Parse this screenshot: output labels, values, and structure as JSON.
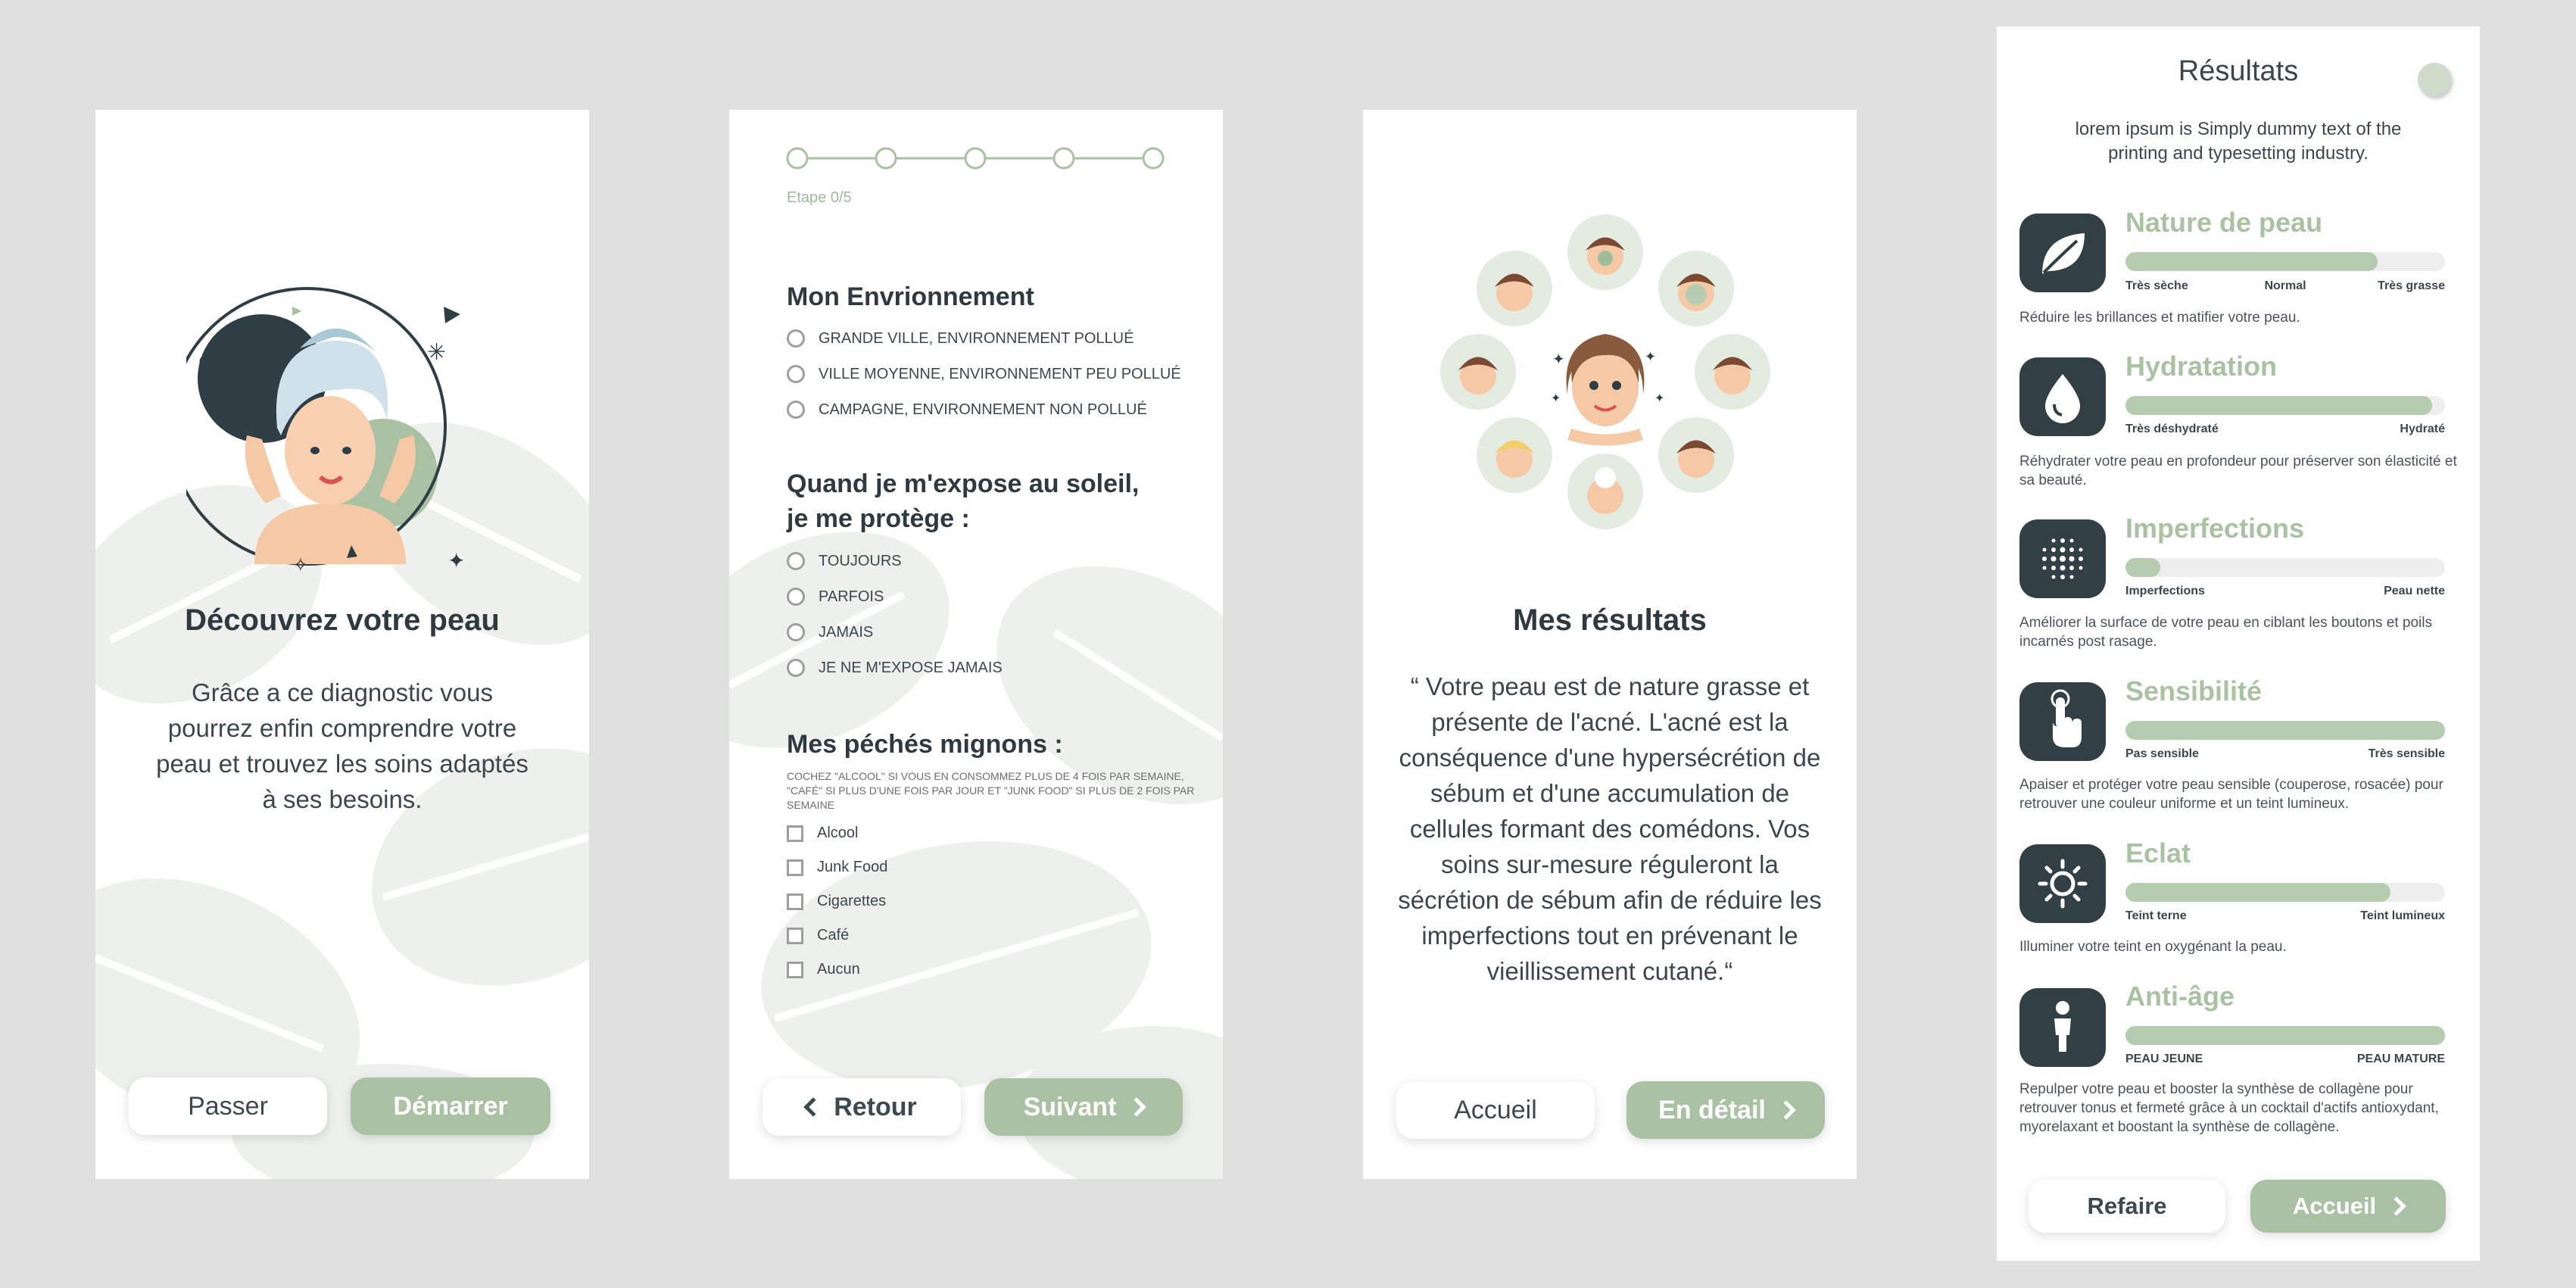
{
  "colors": {
    "background": "#e0e0e0",
    "accent_green": "#aac1a4",
    "dark": "#323f45",
    "light_green_text": "#9fbb99"
  },
  "intro": {
    "title": "Découvrez votre peau",
    "body": "Grâce a ce diagnostic vous pourrez enfin comprendre votre peau et trouvez les soins adaptés à ses besoins.",
    "skip_label": "Passer",
    "start_label": "Démarrer"
  },
  "questionnaire": {
    "step_label": "Etape 0/5",
    "steps_total": 5,
    "q1_title": "Mon Envrionnement",
    "q1_options": [
      "GRANDE VILLE, ENVIRONNEMENT POLLUÉ",
      "VILLE MOYENNE, ENVIRONNEMENT PEU POLLUÉ",
      "CAMPAGNE, ENVIRONNEMENT NON POLLUÉ"
    ],
    "q2_title_line1": "Quand je m'expose au soleil,",
    "q2_title_line2": "je me protège :",
    "q2_options": [
      "TOUJOURS",
      "PARFOIS",
      "JAMAIS",
      "JE NE M'EXPOSE JAMAIS"
    ],
    "q3_title": "Mes péchés mignons :",
    "q3_note": "COCHEZ \"ALCOOL\" SI VOUS EN CONSOMMEZ PLUS DE 4 FOIS PAR SEMAINE, \"CAFÉ\" SI PLUS D'UNE FOIS PAR JOUR ET \"JUNK FOOD\" SI PLUS DE 2 FOIS PAR SEMAINE",
    "q3_options": [
      "Alcool",
      "Junk Food",
      "Cigarettes",
      "Café",
      "Aucun"
    ],
    "back_label": "Retour",
    "next_label": "Suivant"
  },
  "my_results": {
    "title": "Mes résultats",
    "body": "“ Votre peau est de nature grasse et présente de l'acné. L'acné est la conséquence d'une hypersécrétion de sébum et d'une accumulation de cellules formant des comédons. Vos soins sur-mesure réguleront la sécrétion de sébum afin de réduire les imperfections tout en prévenant le vieillissement cutané.“",
    "home_label": "Accueil",
    "detail_label": "En détail"
  },
  "results": {
    "title": "Résultats",
    "intro": "lorem ipsum is Simply dummy text of the printing and typesetting industry.",
    "criteria": [
      {
        "name": "Nature de peau",
        "icon": "leaf-icon",
        "level": 0.79,
        "scale": [
          "Très sèche",
          "Normal",
          "Très grasse"
        ],
        "desc": "Réduire les brillances et matifier votre peau."
      },
      {
        "name": "Hydratation",
        "icon": "drop-icon",
        "level": 0.96,
        "scale": [
          "Très déshydraté",
          "Hydraté"
        ],
        "desc": "Réhydrater votre peau en profondeur pour préserver son élasticité et sa beauté."
      },
      {
        "name": "Imperfections",
        "icon": "dots-icon",
        "level": 0.11,
        "scale": [
          "Imperfections",
          "Peau nette"
        ],
        "desc": "Améliorer la surface de votre peau en ciblant les boutons et poils incarnés post rasage."
      },
      {
        "name": "Sensibilité",
        "icon": "touch-icon",
        "level": 1.0,
        "scale": [
          "Pas sensible",
          "Très sensible"
        ],
        "desc": "Apaiser et protéger votre peau sensible (couperose, rosacée) pour retrouver une couleur uniforme et un teint lumineux."
      },
      {
        "name": "Eclat",
        "icon": "sun-icon",
        "level": 0.83,
        "scale": [
          "Teint terne",
          "Teint lumineux"
        ],
        "desc": "Illuminer votre teint en oxygénant la peau."
      },
      {
        "name": "Anti-âge",
        "icon": "person-icon",
        "level": 1.0,
        "scale": [
          "PEAU JEUNE",
          "PEAU MATURE"
        ],
        "desc": "Repulper votre peau et booster la synthèse de collagène pour retrouver tonus et fermeté grâce à un cocktail d'actifs antioxydant, myorelaxant et boostant la synthèse de collagène."
      }
    ],
    "redo_label": "Refaire",
    "home_label": "Accueil"
  }
}
